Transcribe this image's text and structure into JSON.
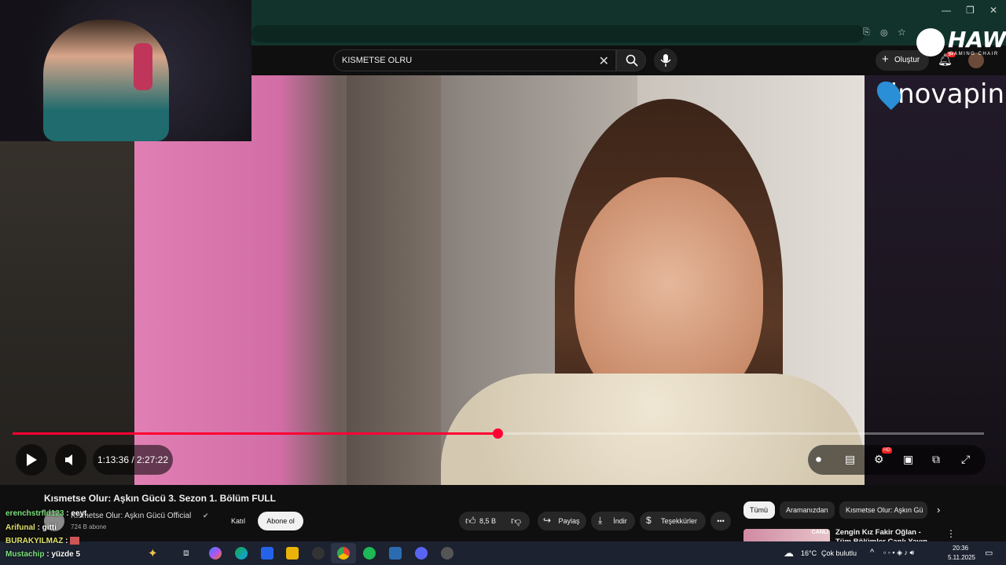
{
  "browser": {
    "window_controls": {
      "minimize": "—",
      "restore": "❐",
      "close": "✕"
    }
  },
  "header": {
    "search_value": "KISMETSE OLRU",
    "create_label": "Oluştur",
    "notification_count": "9+"
  },
  "overlay": {
    "brand1": "HAWK",
    "brand1_sub": "GAMING CHAIR",
    "brand2": "inovapin"
  },
  "player": {
    "time_current": "1:13:36",
    "time_total": "2:27:22",
    "time_display": "1:13:36 / 2:27:22",
    "progress_fraction": 0.499,
    "hd_badge": "HD"
  },
  "video": {
    "title": "Kısmetse Olur: Aşkın Gücü 3. Sezon 1. Bölüm FULL",
    "channel": "Kısmetse Olur: Aşkın Gücü Official",
    "subscribers": "724 B abone",
    "join_label": "Katıl",
    "subscribe_label": "Abone ol",
    "likes": "8,5 B",
    "share_label": "Paylaş",
    "download_label": "İndir",
    "thanks_label": "Teşekkürler"
  },
  "filters": [
    "Tümü",
    "Aramanızdan",
    "Kısmetse Olur: Aşkın Gü"
  ],
  "recommended": {
    "title": "Zengin Kız Fakir Oğlan - Tüm Bölümler Canlı Yayın",
    "badge": "CANLI"
  },
  "chat": [
    {
      "user": "erenchstrfld123",
      "message": "eeyt"
    },
    {
      "user": "Arifunal",
      "message": "gitti"
    },
    {
      "user": "BURAKYILMAZ",
      "message": ""
    },
    {
      "user": "Mustachip",
      "message": "yüzde 5"
    }
  ],
  "taskbar": {
    "weather_temp": "16°C",
    "weather_text": "Çok bulutlu",
    "time": "20:36",
    "date": "5.11.2025"
  },
  "colors": {
    "accent": "#ff0033",
    "chrome_bar": "#12332b",
    "taskbar": "#1c2230"
  }
}
